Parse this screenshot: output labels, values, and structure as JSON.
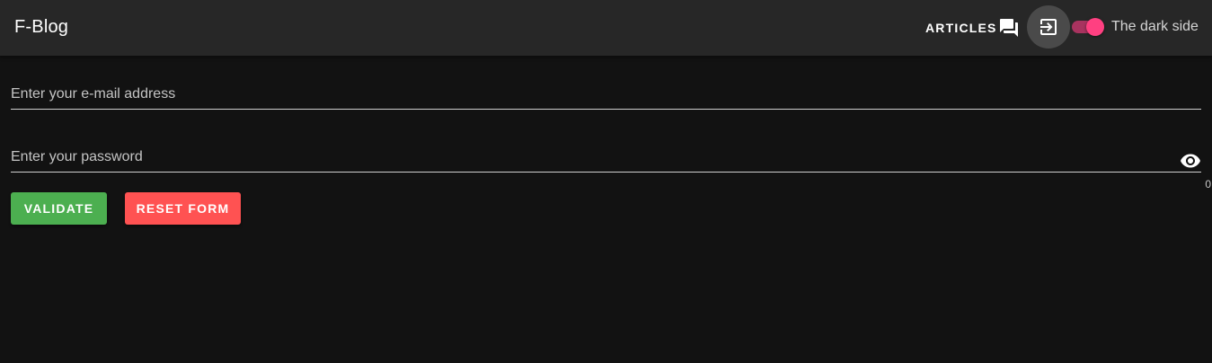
{
  "header": {
    "title": "F-Blog",
    "nav_articles_label": "ARTICLES",
    "articles_icon": "forum-icon",
    "login_icon": "login-icon",
    "dark_mode_label": "The dark side",
    "dark_mode_on": true
  },
  "form": {
    "email": {
      "placeholder": "Enter your e-mail address",
      "value": ""
    },
    "password": {
      "placeholder": "Enter your password",
      "value": "",
      "toggle_icon": "eye-icon",
      "counter": "0"
    },
    "validate_label": "VALIDATE",
    "reset_label": "RESET FORM"
  },
  "colors": {
    "appbar": "#272727",
    "background": "#121212",
    "validate": "#4caf50",
    "reset": "#ff5252",
    "switch_accent": "#ff4081"
  }
}
